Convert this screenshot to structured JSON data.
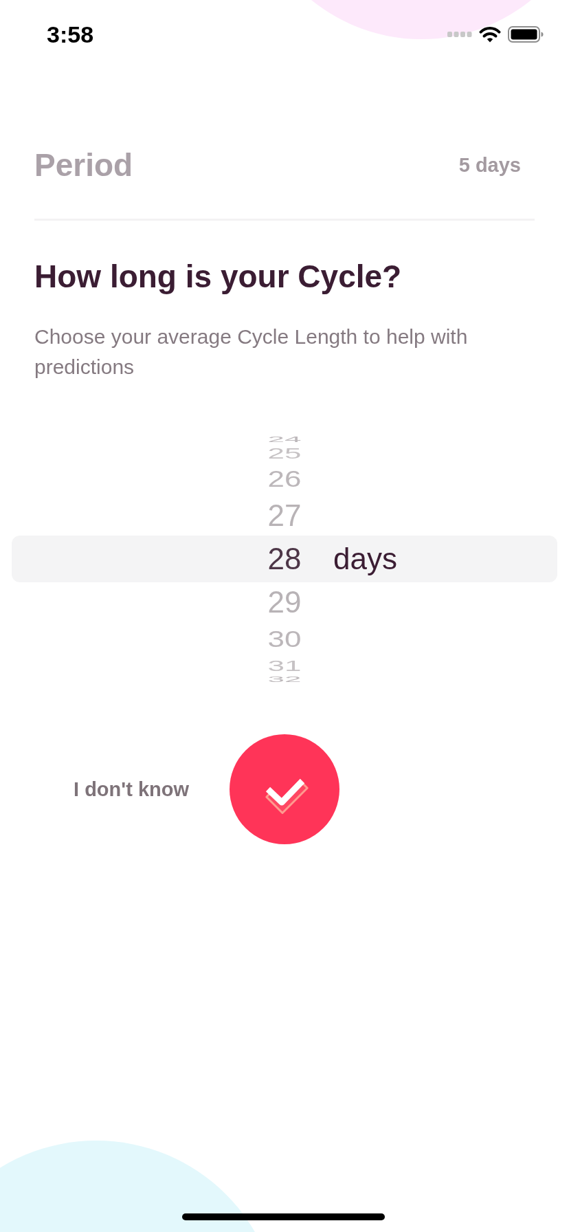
{
  "status_bar": {
    "time": "3:58"
  },
  "summary": {
    "label": "Period",
    "value": "5 days"
  },
  "question": {
    "title": "How long is your Cycle?",
    "description": "Choose your average Cycle Length to help with predictions"
  },
  "picker": {
    "unit": "days",
    "items": [
      {
        "label": "24",
        "selected": false
      },
      {
        "label": "25",
        "selected": false
      },
      {
        "label": "26",
        "selected": false
      },
      {
        "label": "27",
        "selected": false
      },
      {
        "label": "28",
        "selected": true
      },
      {
        "label": "29",
        "selected": false
      },
      {
        "label": "30",
        "selected": false
      },
      {
        "label": "31",
        "selected": false
      },
      {
        "label": "32",
        "selected": false
      }
    ]
  },
  "skip_button": {
    "label": "I don't know"
  }
}
